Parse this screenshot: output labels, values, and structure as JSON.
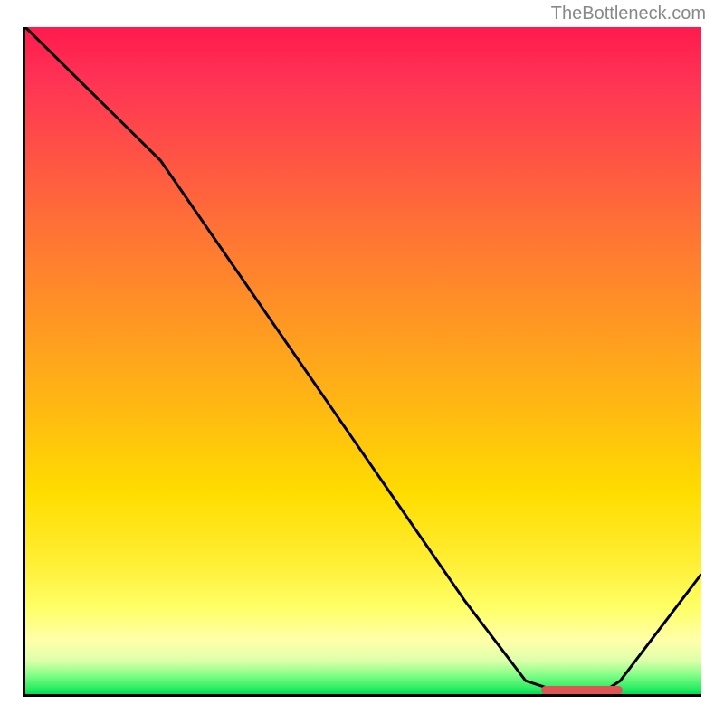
{
  "watermark": "TheBottleneck.com",
  "chart_data": {
    "type": "line",
    "title": "",
    "xlabel": "",
    "ylabel": "",
    "xlim": [
      0,
      100
    ],
    "ylim": [
      0,
      100
    ],
    "x": [
      0,
      8,
      20,
      35,
      50,
      65,
      74,
      80,
      85,
      88,
      100
    ],
    "values": [
      100,
      92,
      80,
      58,
      36,
      14,
      2,
      0,
      0,
      2,
      18
    ],
    "marker_range": [
      76,
      88
    ],
    "annotations": []
  },
  "colors": {
    "gradient_top": "#ff1a4d",
    "gradient_bottom": "#00dd55",
    "line": "#000000",
    "marker": "#dd5555"
  }
}
